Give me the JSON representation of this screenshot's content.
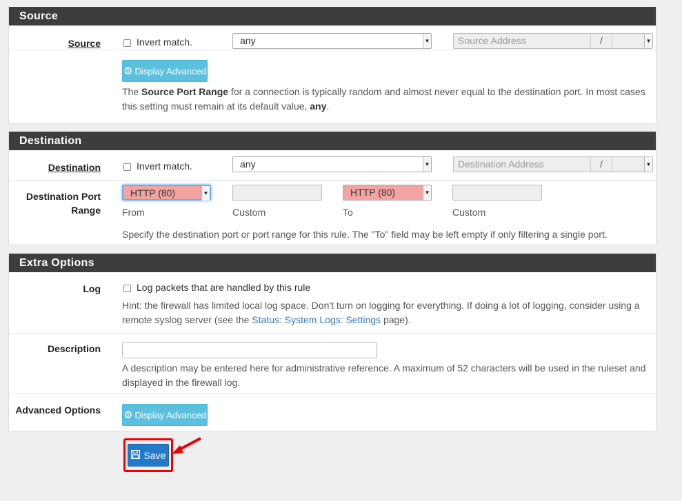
{
  "source_panel": {
    "heading": "Source",
    "source_label": "Source",
    "invert_label": "Invert match.",
    "type_value": "any",
    "address_placeholder": "Source Address",
    "slash": "/",
    "advanced_button": "Display Advanced",
    "help_pre": "The ",
    "help_bold": "Source Port Range",
    "help_mid": " for a connection is typically random and almost never equal to the destination port. In most cases this setting must remain at its default value, ",
    "help_bold2": "any",
    "help_post": "."
  },
  "destination_panel": {
    "heading": "Destination",
    "destination_label": "Destination",
    "invert_label": "Invert match.",
    "type_value": "any",
    "address_placeholder": "Destination Address",
    "slash": "/",
    "port_label_line1": "Destination Port",
    "port_label_line2": "Range",
    "from_value": "HTTP (80)",
    "to_value": "HTTP (80)",
    "from_caption": "From",
    "custom_caption_1": "Custom",
    "to_caption": "To",
    "custom_caption_2": "Custom",
    "help": "Specify the destination port or port range for this rule. The \"To\" field may be left empty if only filtering a single port."
  },
  "extra_panel": {
    "heading": "Extra Options",
    "log_label": "Log",
    "log_checkbox": "Log packets that are handled by this rule",
    "log_hint_pre": "Hint: the firewall has limited local log space. Don't turn on logging for everything. If doing a lot of logging, consider using a remote syslog server (see the ",
    "log_hint_link": "Status: System Logs: Settings",
    "log_hint_post": " page).",
    "description_label": "Description",
    "description_value": "",
    "description_help": "A description may be entered here for administrative reference. A maximum of 52 characters will be used in the ruleset and displayed in the firewall log.",
    "advanced_label": "Advanced Options",
    "advanced_button": "Display Advanced"
  },
  "save_button": "Save",
  "colors": {
    "heading_bg": "#3d3d3d",
    "info_button": "#5bc0de",
    "save_button": "#2579c9",
    "port_highlight": "#f4a3a3",
    "annotation": "#ee0000"
  }
}
